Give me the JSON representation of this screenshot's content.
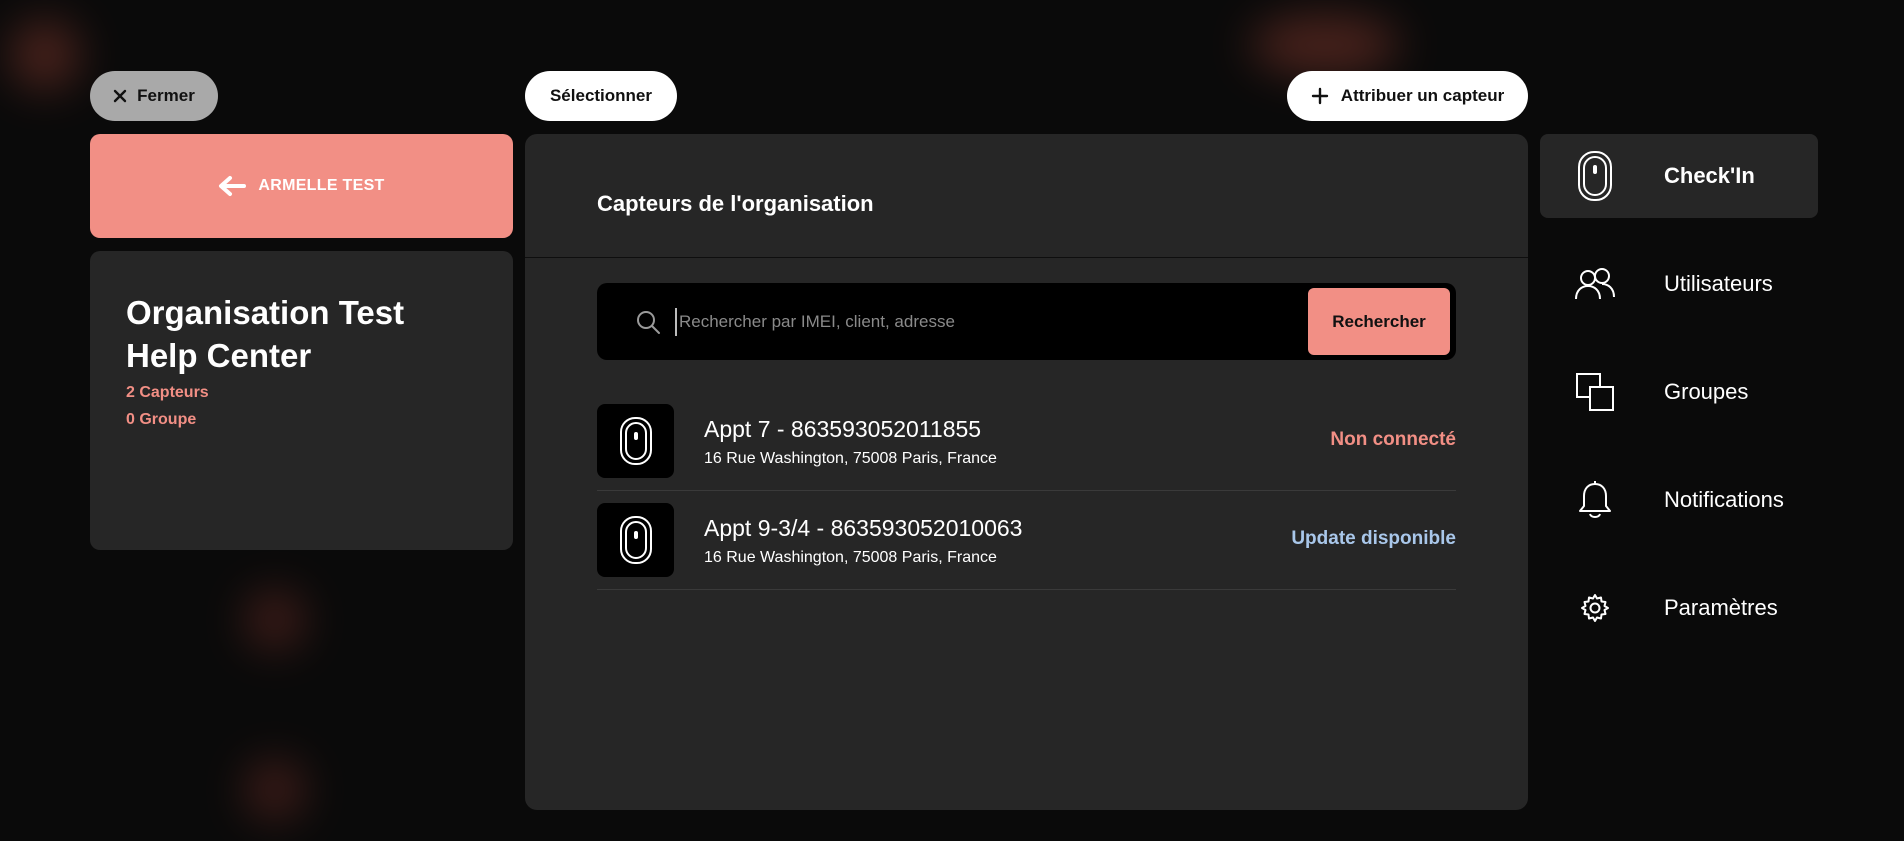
{
  "toolbar": {
    "close_label": "Fermer",
    "select_label": "Sélectionner",
    "assign_label": "Attribuer un capteur"
  },
  "back": {
    "label": "ARMELLE TEST"
  },
  "organization": {
    "name_line1": "Organisation Test",
    "name_line2": "Help Center",
    "sensors_count": "2 Capteurs",
    "groups_count": "0 Groupe"
  },
  "main": {
    "title": "Capteurs de l'organisation",
    "search": {
      "placeholder": "Rechercher par IMEI, client, adresse",
      "value": "",
      "button_label": "Rechercher"
    },
    "sensors": [
      {
        "name": "Appt 7 - 863593052011855",
        "address": "16 Rue Washington, 75008 Paris, France",
        "status": "Non connecté",
        "status_color": "#f28f85"
      },
      {
        "name": "Appt 9-3/4 - 863593052010063",
        "address": "16 Rue Washington, 75008 Paris, France",
        "status": "Update disponible",
        "status_color": "#a9c7ea"
      }
    ]
  },
  "nav": {
    "items": [
      {
        "label": "Check'In",
        "icon": "sensor-icon",
        "active": true
      },
      {
        "label": "Utilisateurs",
        "icon": "users-icon",
        "active": false
      },
      {
        "label": "Groupes",
        "icon": "groups-icon",
        "active": false
      },
      {
        "label": "Notifications",
        "icon": "bell-icon",
        "active": false
      },
      {
        "label": "Paramètres",
        "icon": "gear-icon",
        "active": false
      }
    ]
  },
  "colors": {
    "accent": "#f28f85",
    "panel": "#262626",
    "background": "#0a0a0a"
  }
}
